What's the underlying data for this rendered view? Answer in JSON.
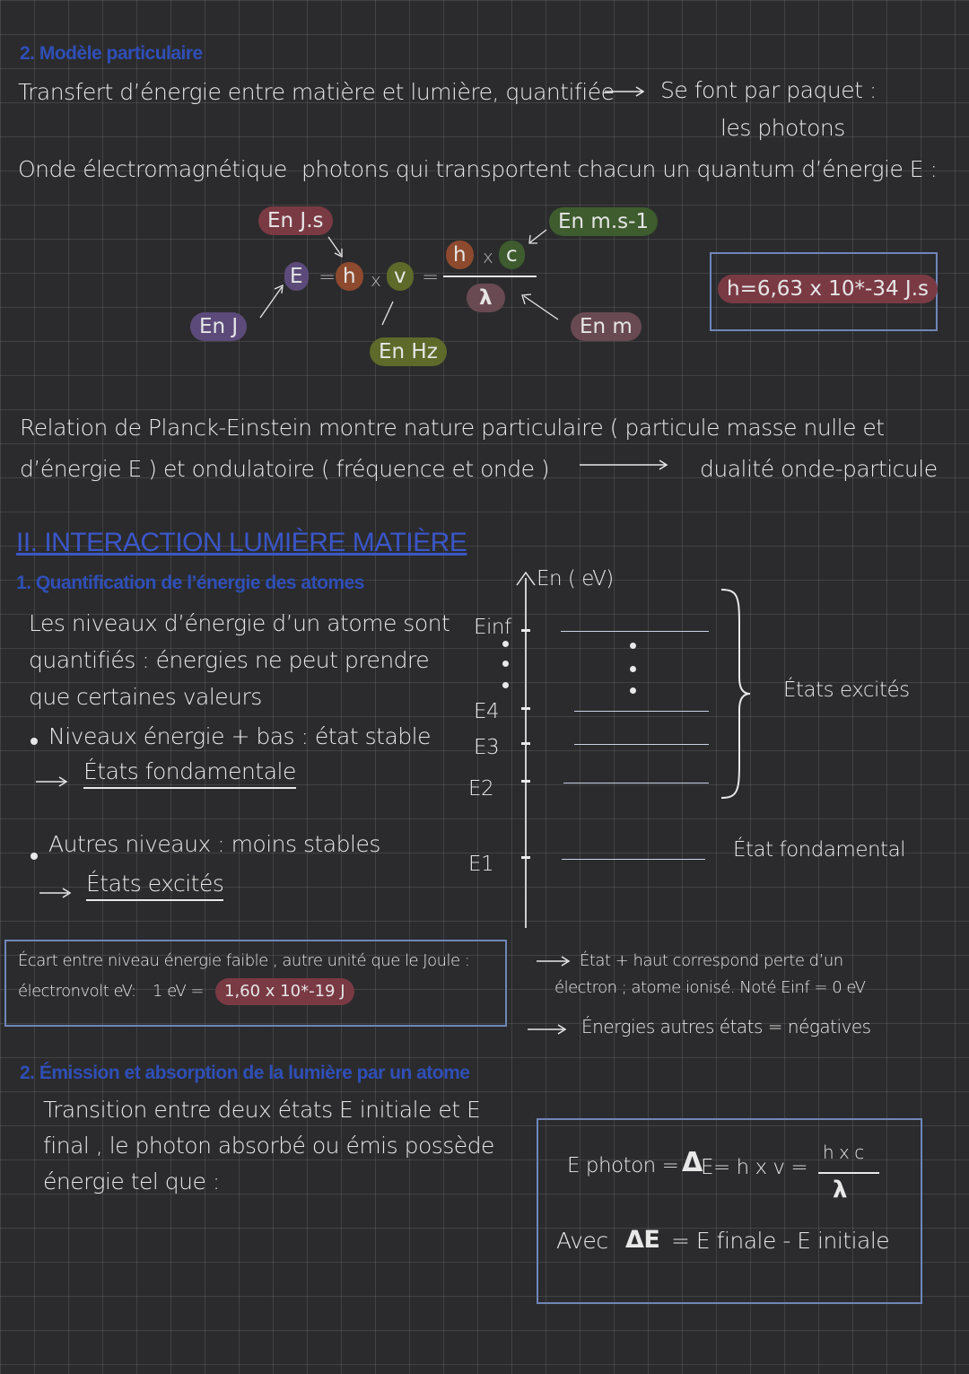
{
  "section_particle": {
    "heading": "2. Modèle particulaire",
    "transfer_line": "Transfert d’énergie entre matière et lumière, quantifiée",
    "packet_line1": "Se font par paquet :",
    "packet_line2": "les photons",
    "wave_label": "Onde électromagnétique",
    "photons_line": "photons qui transportent chacun un quantum d’énergie E :",
    "formula": {
      "unit_js": "En J.s",
      "unit_ms": "En m.s-1",
      "E": "E",
      "eq1": "=",
      "h1": "h",
      "x1": "x",
      "nu": "v",
      "eq2": "=",
      "h2": "h",
      "x2": "x",
      "c": "c",
      "lambda": "λ",
      "unit_j": "En J",
      "unit_hz": "En Hz",
      "unit_m": "En m",
      "planck_const": "h=6,63 x 10*-34 J.s"
    },
    "relation_line1": "Relation de Planck-Einstein montre nature particulaire ( particule masse nulle et",
    "relation_line2": "d’énergie E ) et ondulatoire ( fréquence et onde )",
    "duality": "dualité onde-particule"
  },
  "section_interaction": {
    "title": "II. INTERACTION LUMIÈRE MATIÈRE",
    "sub1": "1. Quantification de l’énergie des atomes",
    "levels_text1": "Les niveaux d’énergie d’un atome sont",
    "levels_text2": "quantifiés : énergies ne peut prendre",
    "levels_text3": "que certaines valeurs",
    "bullet1": "Niveaux énergie + bas : état stable",
    "ground_state": "États fondamentale",
    "bullet2": "Autres niveaux : moins stables",
    "excited_state": "États excités",
    "diagram": {
      "axis_label": "En ( eV)",
      "einf": "Einf",
      "e4": "E4",
      "e3": "E3",
      "e2": "E2",
      "e1": "E1",
      "excited_label": "États excités",
      "ground_label": "État fondamental"
    },
    "ev_box_line1": "Écart entre niveau énergie faible , autre unité que le Joule :",
    "ev_box_line2a": "électronvolt eV:",
    "ev_box_line2b": "1 eV =",
    "ev_value": "1,60 x 10*-19 J",
    "note1_line1": "État + haut correspond perte d’un",
    "note1_line2": "électron ; atome ionisé. Noté Einf = 0 eV",
    "note2": "Énergies autres états = négatives",
    "sub2": "2. Émission et absorption de la lumière par un atome",
    "transition1": "Transition entre deux états E initiale et E",
    "transition2": "final , le photon absorbé ou émis possède",
    "transition3": "énergie tel que :",
    "photon_formula": {
      "lhs": "E photon =",
      "delta": "Δ",
      "mid": "E= h x v =",
      "num": "h x c",
      "den": "λ",
      "avec": "Avec",
      "delta2": "ΔE",
      "rhs": "= E finale - E initiale"
    }
  },
  "colors": {
    "background": "#2b2b2d",
    "blue_heading": "#2f4fb8",
    "pill_red": "#7a3a44",
    "pill_orange": "#8e4a2e",
    "pill_purple": "#5c4b7a",
    "pill_green": "#3e5c2e",
    "pill_olive": "#5e6a2a",
    "box_border": "#6f86b8"
  }
}
